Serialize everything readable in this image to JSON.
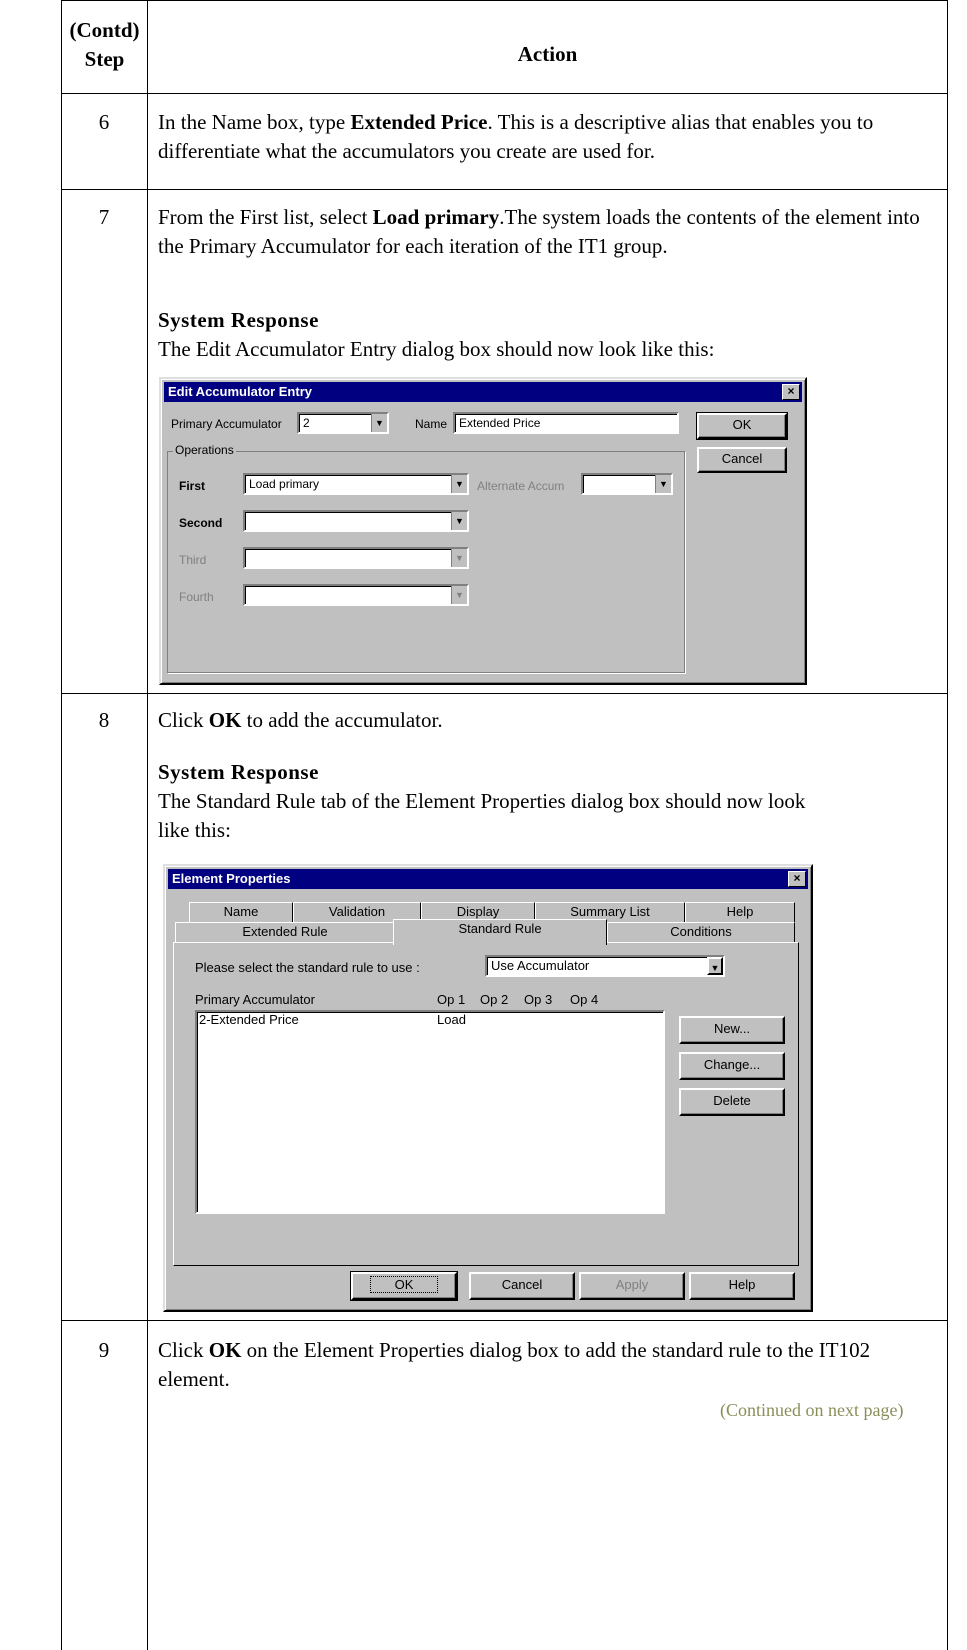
{
  "table": {
    "header": {
      "step": "(Contd)\nStep",
      "step_line1": "(Contd)",
      "step_line2": "Step",
      "action": "Action"
    },
    "rows": [
      {
        "step": "6",
        "text_parts": [
          "In the Name box, type ",
          "Extended Price",
          ". This is a descriptive alias that enables you to differentiate what the accumulators you create are used for."
        ]
      },
      {
        "step": "7",
        "text_parts": [
          "From the First list, select ",
          "Load primary",
          ".The system loads the contents of the element into the Primary Accumulator for each iteration of the IT1 group."
        ],
        "response_title": "System Response",
        "response_text": "The Edit Accumulator Entry dialog box should now look like this:"
      },
      {
        "step": "8",
        "text_parts": [
          "Click ",
          "OK",
          " to add the accumulator."
        ],
        "response_title": "System Response",
        "response_text": "The Standard Rule tab of the Element Properties dialog box should now look like this:"
      },
      {
        "step": "9",
        "text_parts": [
          "Click ",
          "OK",
          " on the Element Properties dialog box to add the standard rule to the IT102 element."
        ],
        "continued": "(Continued on next page)"
      }
    ]
  },
  "edit_accumulator_dialog": {
    "title": "Edit Accumulator Entry",
    "close_glyph": "×",
    "primary_label": "Primary Accumulator",
    "primary_value": "2",
    "name_label": "Name",
    "name_value": "Extended Price",
    "ok_label": "OK",
    "cancel_label": "Cancel",
    "operations_label": "Operations",
    "first_label": "First",
    "first_value": "Load primary",
    "alternate_label": "Alternate Accum",
    "second_label": "Second",
    "third_label": "Third",
    "fourth_label": "Fourth"
  },
  "element_properties_dialog": {
    "title": "Element Properties",
    "close_glyph": "×",
    "tabs_row1": [
      "Name",
      "Validation",
      "Display",
      "Summary List",
      "Help"
    ],
    "tabs_row2": [
      "Extended Rule",
      "Standard Rule",
      "Conditions"
    ],
    "active_tab": "Standard Rule",
    "select_label": "Please select the standard rule to use :",
    "select_value": "Use Accumulator",
    "columns": [
      "Primary Accumulator",
      "Op 1",
      "Op 2",
      "Op 3",
      "Op 4"
    ],
    "rows": [
      {
        "accumulator": "2-Extended Price",
        "op1": "Load"
      }
    ],
    "side_buttons": [
      "New...",
      "Change...",
      "Delete"
    ],
    "bottom_buttons": [
      "OK",
      "Cancel",
      "Apply",
      "Help"
    ]
  },
  "colors": {
    "titlebar": "#000080",
    "dialog_face": "#c0c0c0",
    "continued_text": "#8a8f5a"
  }
}
